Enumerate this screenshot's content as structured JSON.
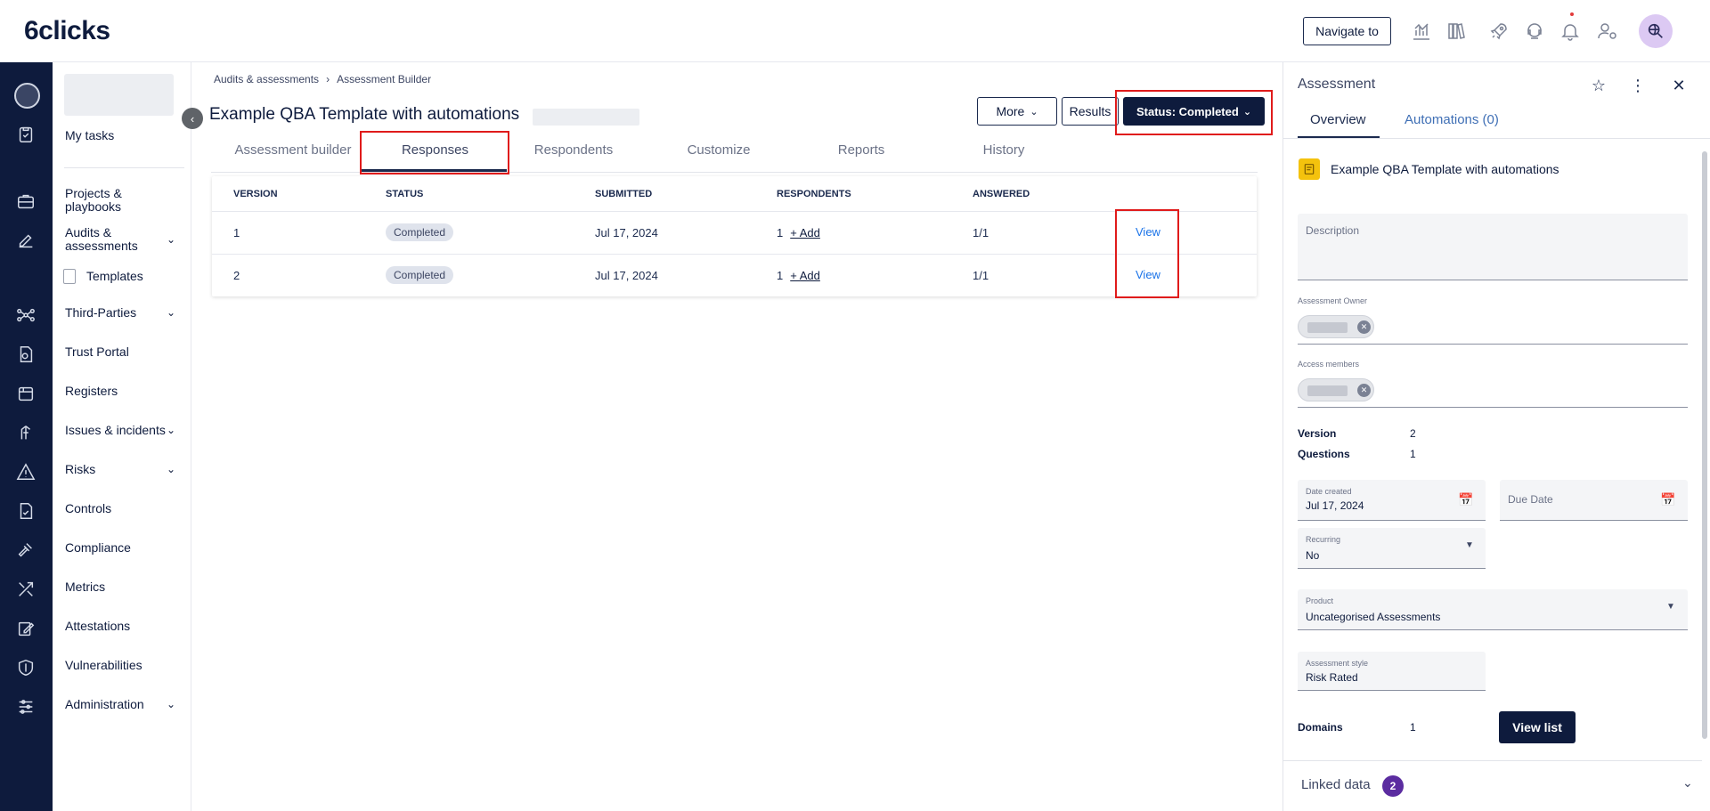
{
  "header": {
    "logo": "6clicks",
    "navigate_to": "Navigate to"
  },
  "nav": {
    "items": [
      {
        "label": "My tasks"
      },
      {
        "label": "Projects & playbooks"
      },
      {
        "label": "Audits & assessments"
      },
      {
        "label": "Templates"
      },
      {
        "label": "Third-Parties"
      },
      {
        "label": "Trust Portal"
      },
      {
        "label": "Registers"
      },
      {
        "label": "Issues & incidents"
      },
      {
        "label": "Risks"
      },
      {
        "label": "Controls"
      },
      {
        "label": "Compliance"
      },
      {
        "label": "Metrics"
      },
      {
        "label": "Attestations"
      },
      {
        "label": "Vulnerabilities"
      },
      {
        "label": "Administration"
      }
    ]
  },
  "breadcrumb": {
    "parent": "Audits & assessments",
    "separator": "›",
    "current": "Assessment Builder"
  },
  "page": {
    "title": "Example QBA Template with automations",
    "more": "More",
    "results": "Results",
    "status": "Status: Completed"
  },
  "tabs": [
    "Assessment builder",
    "Responses",
    "Respondents",
    "Customize",
    "Reports",
    "History"
  ],
  "table": {
    "headers": [
      "VERSION",
      "STATUS",
      "SUBMITTED",
      "RESPONDENTS",
      "ANSWERED"
    ],
    "rows": [
      {
        "version": "1",
        "status": "Completed",
        "submitted": "Jul 17, 2024",
        "respondents": "1",
        "add": "+ Add",
        "answered": "1/1",
        "view": "View"
      },
      {
        "version": "2",
        "status": "Completed",
        "submitted": "Jul 17, 2024",
        "respondents": "1",
        "add": "+ Add",
        "answered": "1/1",
        "view": "View"
      }
    ]
  },
  "panel": {
    "title": "Assessment",
    "tab_overview": "Overview",
    "tab_automations": "Automations (0)",
    "assessment_name": "Example QBA Template with automations",
    "description_label": "Description",
    "owner_label": "Assessment Owner",
    "access_label": "Access members",
    "version_label": "Version",
    "version_value": "2",
    "questions_label": "Questions",
    "questions_value": "1",
    "date_created_label": "Date created",
    "date_created_value": "Jul 17, 2024",
    "due_date_label": "Due Date",
    "recurring_label": "Recurring",
    "recurring_value": "No",
    "product_label": "Product",
    "product_value": "Uncategorised Assessments",
    "style_label": "Assessment style",
    "style_value": "Risk Rated",
    "domains_label": "Domains",
    "domains_value": "1",
    "view_list": "View list",
    "linked_label": "Linked data",
    "linked_count": "2"
  },
  "colors": {
    "navy": "#0e1b3d",
    "highlight": "#e01b1b",
    "link": "#1a73e8",
    "linked_badge": "#5b2ca0",
    "assessment_icon": "#f4c20d"
  }
}
